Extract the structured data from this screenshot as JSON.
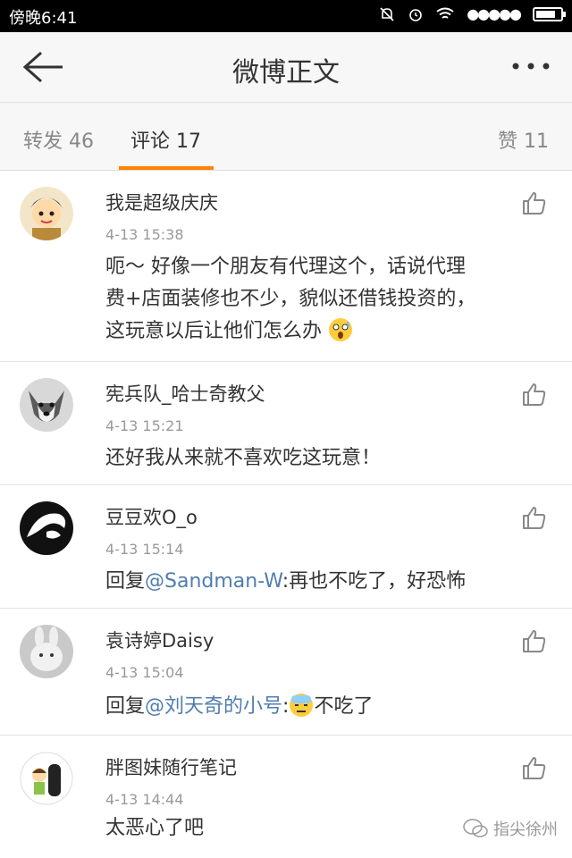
{
  "status_bar": {
    "time": "傍晚6:41",
    "signal": "●●●●●"
  },
  "header": {
    "title": "微博正文"
  },
  "tabs": [
    {
      "label": "转发 46",
      "active": false
    },
    {
      "label": "评论 17",
      "active": true
    },
    {
      "label": "赞 11",
      "active": false
    }
  ],
  "comments": [
    {
      "user": "我是超级庆庆",
      "time": "4-13 15:38",
      "text_lines": [
        "呃～ 好像一个朋友有代理这个，话说代理",
        "费+店面装修也不少，貌似还借钱投资的，",
        "这玩意以后让他们怎么办"
      ]
    },
    {
      "user": "宪兵队_哈士奇教父",
      "time": "4-13 15:21",
      "text": "还好我从来就不喜欢吃这玩意！"
    },
    {
      "user": "豆豆欢O_o",
      "time": "4-13 15:14",
      "reply_prefix": "回复",
      "mention": "@Sandman-W",
      "text": ":再也不吃了，好恐怖"
    },
    {
      "user": "袁诗婷Daisy",
      "time": "4-13 15:04",
      "reply_prefix": "回复",
      "mention": "@刘天奇的小号",
      "text_before_emoji": ":",
      "text": "不吃了"
    },
    {
      "user": "胖图妹随行笔记",
      "time": "4-13 14:44",
      "text": "太恶心了吧"
    }
  ],
  "watermark": "指尖徐州"
}
